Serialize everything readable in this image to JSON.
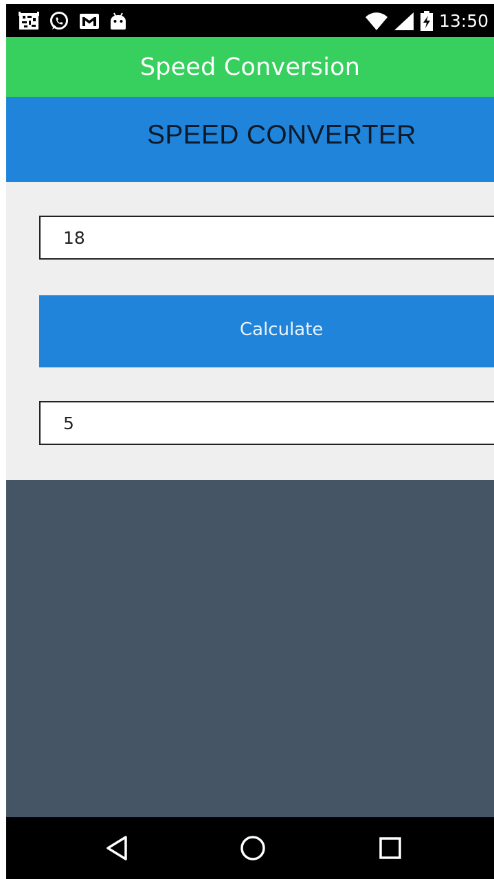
{
  "status_bar": {
    "time": "13:50",
    "left_icons": [
      "notification-grid-icon",
      "whatsapp-icon",
      "gmail-icon",
      "android-icon"
    ],
    "right_icons": [
      "wifi-icon",
      "cellular-signal-icon",
      "battery-icon"
    ]
  },
  "app_bar": {
    "title": "Speed Conversion",
    "color": "#37cf5e"
  },
  "header": {
    "title": "SPEED CONVERTER",
    "color": "#2085da"
  },
  "form": {
    "input_value": "18",
    "button_label": "Calculate",
    "output_value": "5",
    "background": "#efefef"
  },
  "lower_panel": {
    "color": "#455565"
  },
  "nav_bar": {
    "buttons": [
      "back-icon",
      "home-icon",
      "recents-icon"
    ]
  }
}
